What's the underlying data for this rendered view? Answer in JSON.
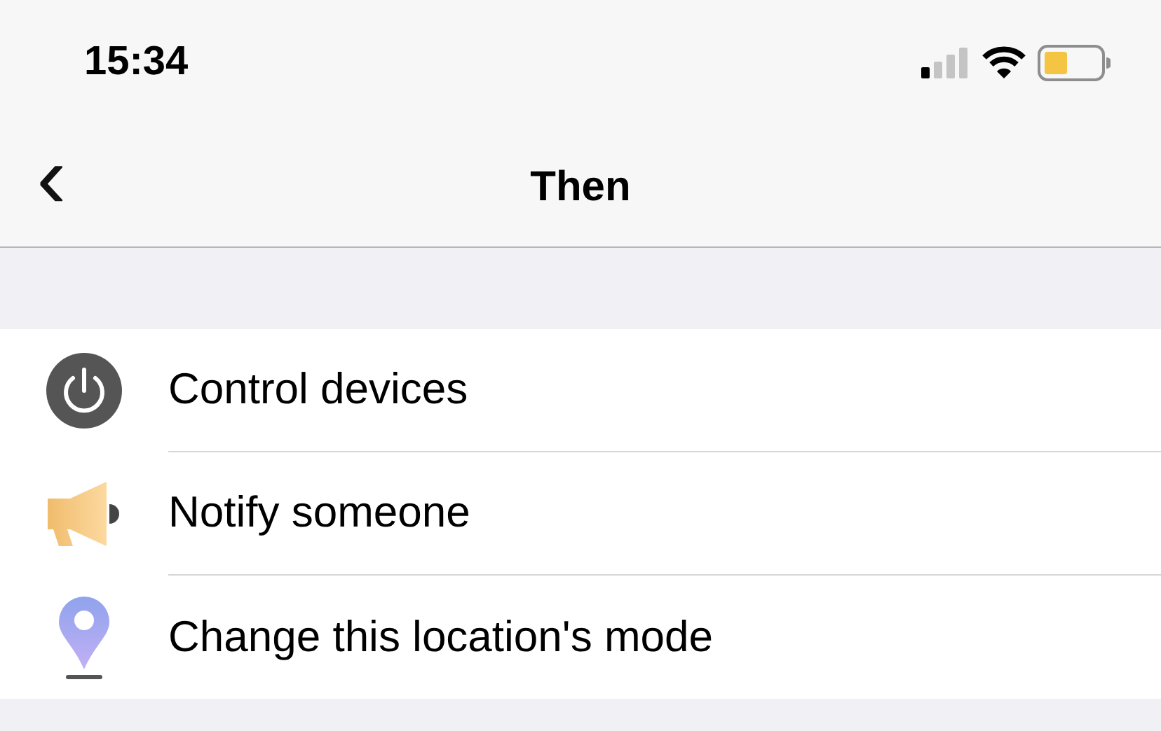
{
  "status_bar": {
    "time": "15:34"
  },
  "nav_bar": {
    "back": "‹",
    "title": "Then"
  },
  "actions": [
    {
      "kind": "power",
      "label": "Control devices"
    },
    {
      "kind": "megaphone",
      "label": "Notify someone"
    },
    {
      "kind": "pin",
      "label": "Change this location's mode"
    }
  ]
}
